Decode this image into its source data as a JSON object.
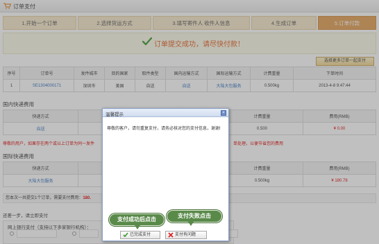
{
  "header": {
    "title": "订单支付"
  },
  "steps": [
    "1.开始一个订单",
    "2.选择货运方式",
    "3.填写寄件人 收件人信息",
    "4.生成订单",
    "5.订单付款"
  ],
  "success_msg": "订单提交成功，请尽快付款！",
  "more_button": "选择更多订单一起支付",
  "order_table": {
    "headers": [
      "序号",
      "订单号",
      "发件城市",
      "目的国家",
      "取件类型",
      "国内运输方式",
      "国际运输方式",
      "计费重量",
      "下单时间"
    ],
    "row": [
      "1",
      "SE1304000171",
      "深圳市",
      "美国",
      "自送",
      "自送",
      "大陆大包服务",
      "0.500kg",
      "2013-4-8 9:47:44"
    ]
  },
  "domestic": {
    "title": "国内快递费用",
    "headers": [
      "快递方式",
      "计费重量",
      "费用(RMB)"
    ],
    "row": [
      "自送",
      "0.500",
      "¥ 0.00"
    ],
    "note_left": "尊敬的用户，如果存在两个或以上订单为同一发件",
    "note_right": "单处理，以便节省您的费用"
  },
  "international": {
    "title": "国际快递费用",
    "headers": [
      "快递方式",
      "计费重量",
      "费用(RMB)"
    ],
    "row": [
      "大陆大包服务",
      "0.500kg",
      "¥ 180.78"
    ]
  },
  "summary": {
    "prefix": "您本次一共提交1个订单，需要支付费用：",
    "amount": "180."
  },
  "payment": {
    "step_label": "还差一步，请立即支付",
    "option_label": "网上银行支付（支持以下多家银行机构）："
  },
  "dialog": {
    "title": "温馨提示",
    "close": "×",
    "body": "尊敬的客户，请勿重复支付，请务必核对您的支付信息，谢谢!",
    "btn_done": "已完成支付",
    "btn_problem": "支付有问题"
  },
  "annotations": {
    "success": "支付成功后点击",
    "fail": "支付失败点击"
  },
  "colors": {
    "accent": "#e29e52",
    "alert": "#e25b1a",
    "price": "#dd0000",
    "bubble": "#5a8a4a"
  }
}
